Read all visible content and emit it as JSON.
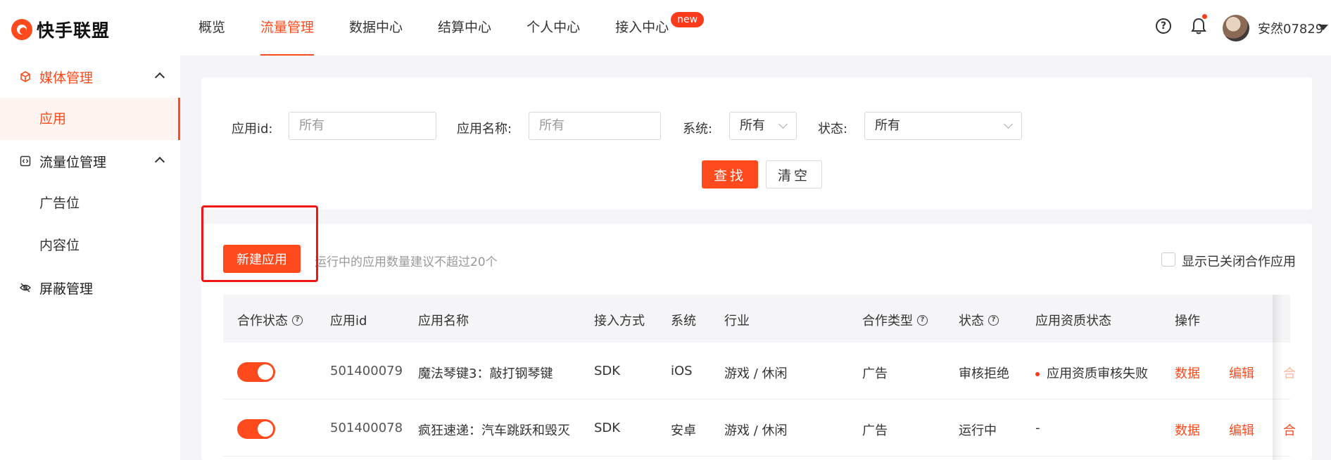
{
  "brand": {
    "name": "快手联盟"
  },
  "nav": [
    {
      "label": "概览"
    },
    {
      "label": "流量管理"
    },
    {
      "label": "数据中心"
    },
    {
      "label": "结算中心"
    },
    {
      "label": "个人中心"
    },
    {
      "label": "接入中心",
      "badge": "new"
    }
  ],
  "header": {
    "username": "安然07829"
  },
  "sidebar": {
    "media_group": "媒体管理",
    "app": "应用",
    "slot_group": "流量位管理",
    "ad_slot": "广告位",
    "content_slot": "内容位",
    "block_group": "屏蔽管理"
  },
  "filters": {
    "app_id_label": "应用id:",
    "app_id_placeholder": "所有",
    "app_name_label": "应用名称:",
    "app_name_placeholder": "所有",
    "system_label": "系统:",
    "system_value": "所有",
    "status_label": "状态:",
    "status_value": "所有",
    "search_button": "查找",
    "clear_button": "清空"
  },
  "list": {
    "new_button": "新建应用",
    "hint": "运行中的应用数量建议不超过20个",
    "show_closed_label": "显示已关闭合作应用"
  },
  "table": {
    "columns": {
      "coop_status": "合作状态",
      "app_id": "应用id",
      "app_name": "应用名称",
      "access": "接入方式",
      "system": "系统",
      "industry": "行业",
      "coop_type": "合作类型",
      "status": "状态",
      "qual_status": "应用资质状态",
      "actions": "操作"
    },
    "rows": [
      {
        "app_id": "501400079",
        "app_name": "魔法琴键3：敲打钢琴键",
        "access": "SDK",
        "system": "iOS",
        "industry": "游戏 / 休闲",
        "coop_type": "广告",
        "status": "审核拒绝",
        "qual_status": "应用资质审核失败",
        "action_data": "数据",
        "action_edit": "编辑",
        "action_more": "合"
      },
      {
        "app_id": "501400078",
        "app_name": "疯狂速递：汽车跳跃和毁灭",
        "access": "SDK",
        "system": "安卓",
        "industry": "游戏 / 休闲",
        "coop_type": "广告",
        "status": "运行中",
        "qual_status": "-",
        "action_data": "数据",
        "action_edit": "编辑",
        "action_more": "合"
      }
    ]
  },
  "colors": {
    "accent": "#fe4a1d",
    "highlight_border": "#ef1616"
  }
}
